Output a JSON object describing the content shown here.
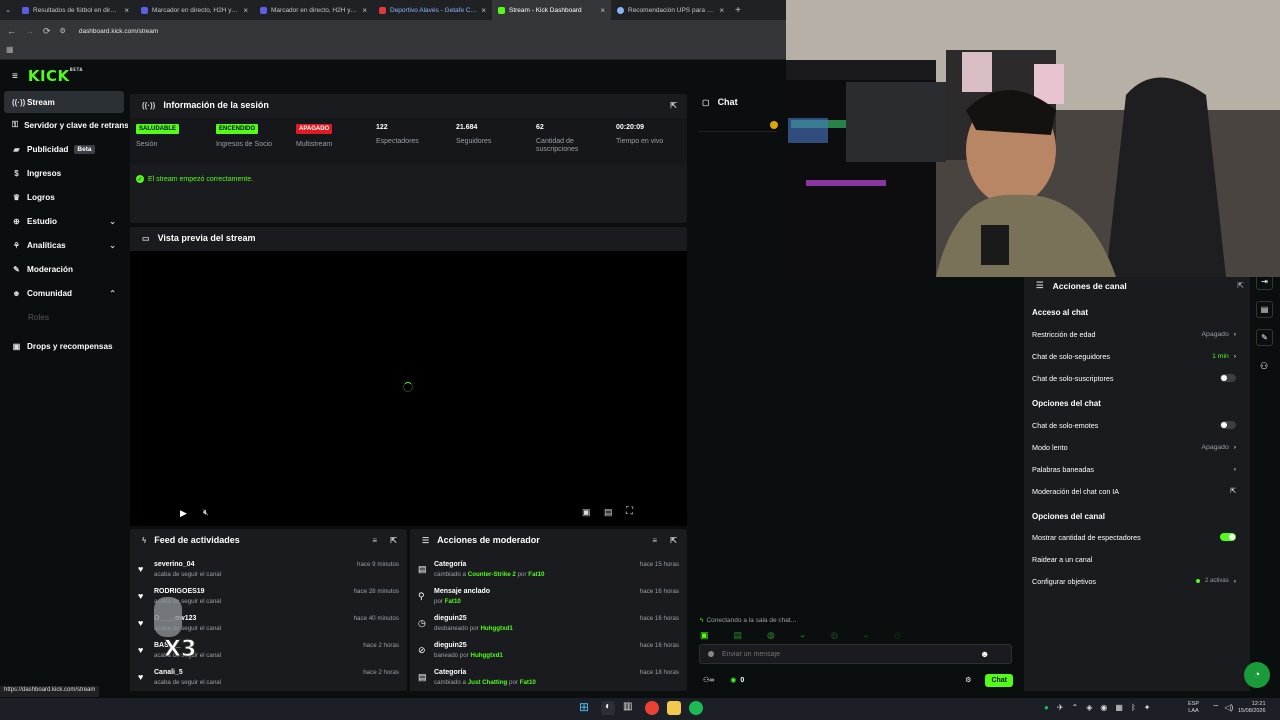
{
  "browser": {
    "tabs": [
      {
        "title": "Resultados de fútbol en directo",
        "color": "#5b5fe6"
      },
      {
        "title": "Marcador en directo, H2H y ali",
        "color": "#5b5fe6"
      },
      {
        "title": "Marcador en directo, H2H y ali",
        "color": "#5b5fe6"
      },
      {
        "title": "Deportivo Alavés - Getafe CF F",
        "color": "#e0393e"
      },
      {
        "title": "Stream - Kick Dashboard",
        "color": "#53fc18"
      },
      {
        "title": "Recomendación UPS para PC G",
        "color": "#8ab4f8"
      }
    ],
    "url": "dashboard.kick.com/stream",
    "status_url": "https://dashboard.kick.com/stream"
  },
  "brand": {
    "logo": "KICK",
    "logo_sup": "BETA",
    "accent": "#53fc18"
  },
  "sidebar": {
    "items": [
      {
        "label": "Stream",
        "icon": "broadcast-icon"
      },
      {
        "label": "Servidor y clave de retransmisión",
        "icon": "key-icon"
      },
      {
        "label": "Publicidad",
        "icon": "megaphone-icon",
        "badge": "Beta"
      },
      {
        "label": "Ingresos",
        "icon": "dollar-icon"
      },
      {
        "label": "Logros",
        "icon": "trophy-icon"
      },
      {
        "label": "Estudio",
        "icon": "studio-icon"
      },
      {
        "label": "Analíticas",
        "icon": "chart-icon"
      },
      {
        "label": "Moderación",
        "icon": "wrench-icon"
      },
      {
        "label": "Comunidad",
        "icon": "people-icon"
      },
      {
        "label": "Roles",
        "icon": ""
      },
      {
        "label": "Drops y recompensas",
        "icon": "gift-icon"
      }
    ]
  },
  "session": {
    "title": "Información de la sesión",
    "stats": [
      {
        "value": "SALUDABLE",
        "label": "Sesión",
        "pill": "green"
      },
      {
        "value": "ENCENDIDO",
        "label": "Ingresos de Socio",
        "pill": "green"
      },
      {
        "value": "APAGADO",
        "label": "Multistream",
        "pill": "red"
      },
      {
        "value": "122",
        "label": "Espectadores"
      },
      {
        "value": "21.684",
        "label": "Seguidores"
      },
      {
        "value": "62",
        "label": "Cantidad de suscripciones"
      },
      {
        "value": "00:20:09",
        "label": "Tiempo en vivo"
      }
    ],
    "message": "El stream empezó correctamente."
  },
  "preview": {
    "title": "Vista previa del stream"
  },
  "activity": {
    "title": "Feed de actividades",
    "items": [
      {
        "user": "severino_04",
        "action": "acaba de seguir el canal",
        "time": "hace 9 minutos"
      },
      {
        "user": "RODRIGOES19",
        "action": "acaba de seguir el canal",
        "time": "hace 28 minutos"
      },
      {
        "user": "O____ow123",
        "action": "acaba de seguir el canal",
        "time": "hace 40 minutos"
      },
      {
        "user": "BAS___",
        "action": "acaba de seguir el canal",
        "time": "hace 2 horas"
      },
      {
        "user": "Canali_5",
        "action": "acaba de seguir el canal",
        "time": "hace 2 horas"
      }
    ]
  },
  "mod_actions": {
    "title": "Acciones de moderador",
    "items": [
      {
        "title": "Categoría",
        "pre": "cambiado a",
        "target": "Counter-Strike 2",
        "mid": "por",
        "by": "Fat10",
        "time": "hace 15 horas",
        "icon": "category-icon"
      },
      {
        "title": "Mensaje anclado",
        "pre": "por",
        "target": "Fat10",
        "mid": "",
        "by": "",
        "time": "hace 16 horas",
        "icon": "pin-icon"
      },
      {
        "title": "dieguin25",
        "pre": "desbaneado por",
        "target": "Huhggtxd1",
        "mid": "",
        "by": "",
        "time": "hace 16 horas",
        "icon": "clock-icon"
      },
      {
        "title": "dieguin25",
        "pre": "baneado por",
        "target": "Huhggtxd1",
        "mid": "",
        "by": "",
        "time": "hace 16 horas",
        "icon": "ban-icon"
      },
      {
        "title": "Categoría",
        "pre": "cambiado a",
        "target": "Just Chatting",
        "mid": "por",
        "by": "Fat10",
        "time": "hace 18 horas",
        "icon": "category-icon"
      }
    ]
  },
  "chat": {
    "title": "Chat",
    "connecting": "Conectando a la sala de chat...",
    "placeholder": "Enviar un mensaje",
    "count": "0",
    "send_label": "Chat"
  },
  "channel_actions": {
    "title": "Acciones de canal",
    "sections": {
      "access": "Acceso al chat",
      "options": "Opciones del chat",
      "channel": "Opciones del canal"
    },
    "rows": {
      "age": {
        "label": "Restricción de edad",
        "value": "Apagado"
      },
      "followers": {
        "label": "Chat de solo-seguidores",
        "value": "1 min"
      },
      "subs": {
        "label": "Chat de solo-suscriptores"
      },
      "emotes": {
        "label": "Chat de solo-emotes"
      },
      "slow": {
        "label": "Modo lento",
        "value": "Apagado"
      },
      "banned": {
        "label": "Palabras baneadas"
      },
      "ai": {
        "label": "Moderación del chat con IA"
      },
      "viewers": {
        "label": "Mostrar cantidad de espectadores"
      },
      "raid": {
        "label": "Raidear a un canal"
      },
      "goals": {
        "label": "Configurar objetivos",
        "value": "2 activas"
      }
    }
  },
  "taskbar": {
    "lang": "ESP",
    "lang2": "LAA",
    "time": "12:21",
    "date": "15/08/2026"
  }
}
